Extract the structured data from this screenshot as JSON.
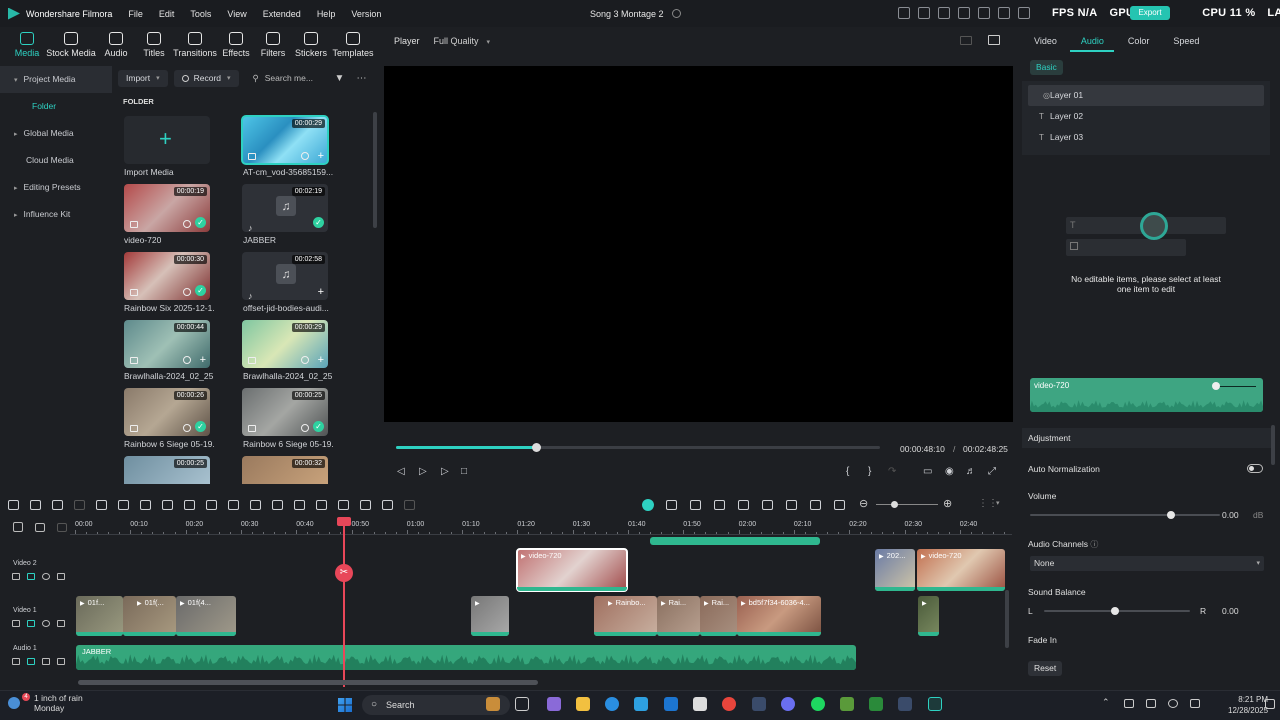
{
  "titlebar": {
    "app_name": "Wondershare Filmora",
    "menu": [
      "File",
      "Edit",
      "Tools",
      "View",
      "Extended",
      "Help",
      "Version"
    ],
    "project_name": "Song 3 Montage 2",
    "gpu_overlay": [
      "FPS N/A",
      "GPU",
      "CPU 11 %",
      "LAT N/A"
    ],
    "export_label": "Export"
  },
  "toolbar": {
    "items": [
      "Media",
      "Stock Media",
      "Audio",
      "Titles",
      "Transitions",
      "Effects",
      "Filters",
      "Stickers",
      "Templates"
    ],
    "active": "Media"
  },
  "sidebar": {
    "items": [
      "Project Media",
      "Folder",
      "Global Media",
      "Cloud Media",
      "Editing Presets",
      "Influence Kit"
    ]
  },
  "media_header": {
    "import_label": "Import",
    "record_label": "Record",
    "search_placeholder": "Search me...",
    "folder_label": "FOLDER"
  },
  "media": [
    {
      "name": "Import Media",
      "duration": ""
    },
    {
      "name": "AT-cm_vod-35685159...",
      "duration": "00:00:29"
    },
    {
      "name": "video-720",
      "duration": "00:00:19"
    },
    {
      "name": "JABBER",
      "duration": "00:02:19"
    },
    {
      "name": "Rainbow Six 2025-12-1...",
      "duration": "00:00:30"
    },
    {
      "name": "offset-jid-bodies-audi...",
      "duration": "00:02:58"
    },
    {
      "name": "Brawlhalla-2024_02_25...",
      "duration": "00:00:44"
    },
    {
      "name": "Brawlhalla-2024_02_25...",
      "duration": "00:00:29"
    },
    {
      "name": "Rainbow 6 Siege 05-19...",
      "duration": "00:00:26"
    },
    {
      "name": "Rainbow 6 Siege 05-19...",
      "duration": "00:00:25"
    },
    {
      "name": "",
      "duration": "00:00:25"
    },
    {
      "name": "",
      "duration": "00:00:32"
    }
  ],
  "player": {
    "label": "Player",
    "quality": "Full Quality",
    "current_time": "00:00:48:10",
    "separator": "/",
    "total_time": "00:02:48:25",
    "progress": 0.29
  },
  "right_panel": {
    "tabs": [
      "Video",
      "Audio",
      "Color",
      "Speed"
    ],
    "active_tab": "Audio",
    "basic_label": "Basic",
    "layers": [
      "Layer 01",
      "Layer 02",
      "Layer 03"
    ],
    "no_edit_text": "No editable items, please select at least one item to edit",
    "clip_name": "video-720",
    "adjustment_label": "Adjustment",
    "auto_normalization_label": "Auto Normalization",
    "volume_label": "Volume",
    "volume_value": "0.00",
    "volume_unit": "dB",
    "audio_channels_label": "Audio Channels",
    "audio_channels_value": "None",
    "sound_balance_label": "Sound Balance",
    "balance_l": "L",
    "balance_r": "R",
    "balance_value": "0.00",
    "fade_in_label": "Fade In",
    "reset_label": "Reset"
  },
  "timeline": {
    "ruler": [
      "00:00",
      "00:10",
      "00:20",
      "00:30",
      "00:40",
      "00:50",
      "01:00",
      "01:10",
      "01:20",
      "01:30",
      "01:40",
      "01:50",
      "02:00",
      "02:10",
      "02:20",
      "02:30",
      "02:40"
    ],
    "tracks": [
      "Video 2",
      "Video 1",
      "Audio 1"
    ],
    "video2_clips": [
      "video-720",
      "202...",
      "video-720"
    ],
    "video1_clips": [
      "01f...",
      "01f(...",
      "01f(4...",
      "",
      "Rainbo...",
      "Rai...",
      "Rai...",
      "bd5f7f34-6036-4...",
      ""
    ],
    "audio_clip": "JABBER"
  },
  "taskbar": {
    "weather_line1": "1 inch of rain",
    "weather_line2": "Monday",
    "weather_badge": "4",
    "search_placeholder": "Search",
    "time": "8:21 PM",
    "date": "12/28/2025"
  }
}
